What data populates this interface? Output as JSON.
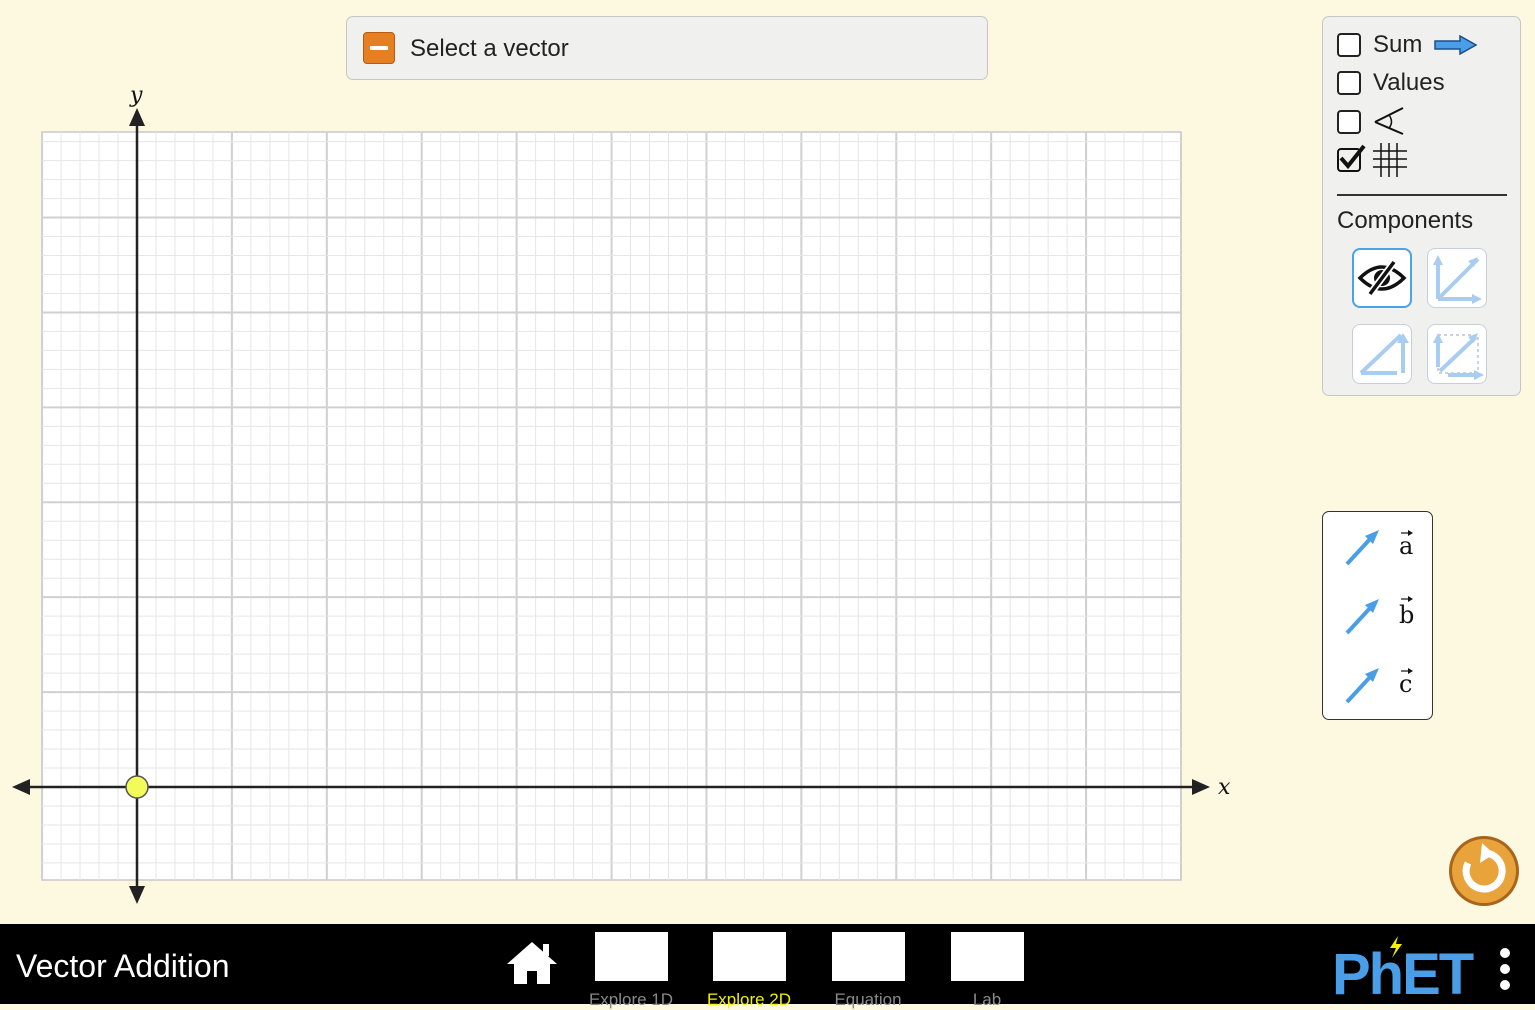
{
  "select_panel": {
    "label": "Select a vector",
    "collapse_icon": "minus-icon"
  },
  "graph": {
    "x_axis_label": "x",
    "y_axis_label": "y",
    "x_range": [
      -1,
      11
    ],
    "y_range": [
      -1,
      7
    ],
    "origin": [
      0,
      0
    ],
    "grid_visible": true,
    "major_grid_step": 1,
    "minor_grid_step": 0.2
  },
  "control_panel": {
    "sum": {
      "label": "Sum",
      "checked": false,
      "icon": "sum-arrow-icon"
    },
    "values": {
      "label": "Values",
      "checked": false
    },
    "angle": {
      "checked": false,
      "icon": "angle-icon"
    },
    "grid": {
      "checked": true,
      "icon": "grid-icon"
    },
    "components_title": "Components",
    "component_buttons": [
      {
        "icon": "eye-slash-icon",
        "selected": true
      },
      {
        "icon": "components-on-axis-icon",
        "selected": false
      },
      {
        "icon": "components-triangle-icon",
        "selected": false
      },
      {
        "icon": "components-parallelogram-icon",
        "selected": false
      }
    ]
  },
  "vector_toolbox": {
    "items": [
      {
        "label": "a",
        "icon": "vector-arrow-icon"
      },
      {
        "label": "b",
        "icon": "vector-arrow-icon"
      },
      {
        "label": "c",
        "icon": "vector-arrow-icon"
      }
    ]
  },
  "navbar": {
    "title": "Vector Addition",
    "screens": [
      {
        "label": "Explore 1D",
        "active": false
      },
      {
        "label": "Explore 2D",
        "active": true
      },
      {
        "label": "Equation",
        "active": false
      },
      {
        "label": "Lab",
        "active": false
      }
    ],
    "logo": "PhET"
  },
  "colors": {
    "background": "#fdf9e1",
    "vector_blue": "#4a9ee8",
    "origin_dot": "#f2fb5a",
    "active_tab": "#f4f000",
    "collapse_button": "#e67e22",
    "reset_button": "#e8a33b"
  }
}
